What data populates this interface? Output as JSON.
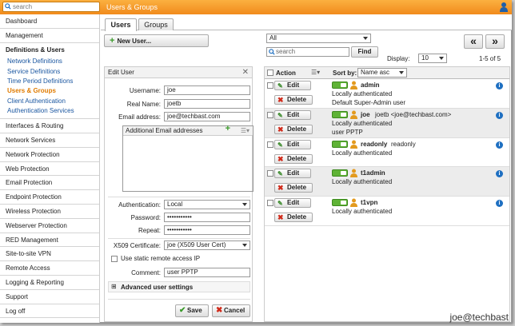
{
  "topbar": {
    "search_placeholder": "search",
    "breadcrumb": "Users & Groups"
  },
  "sidebar": {
    "items_top": [
      "Dashboard",
      "Management"
    ],
    "group": {
      "title": "Definitions & Users",
      "subs": [
        "Network Definitions",
        "Service Definitions",
        "Time Period Definitions",
        "Users & Groups",
        "Client Authentication",
        "Authentication Services"
      ],
      "active": "Users & Groups"
    },
    "items_bottom": [
      "Interfaces & Routing",
      "Network Services",
      "Network Protection",
      "Web Protection",
      "Email Protection",
      "Endpoint Protection",
      "Wireless Protection",
      "Webserver Protection",
      "RED Management",
      "Site-to-site VPN",
      "Remote Access",
      "Logging & Reporting",
      "Support",
      "Log off"
    ]
  },
  "tabs": [
    "Users",
    "Groups"
  ],
  "new_user_label": "New User...",
  "filter": {
    "select_value": "All",
    "search_placeholder": "search",
    "find_label": "Find",
    "display_label": "Display:",
    "display_value": "10",
    "range": "1-5 of 5",
    "prev_label": "«",
    "next_label": "»"
  },
  "edit": {
    "title": "Edit User",
    "username_label": "Username:",
    "username": "joe",
    "realname_label": "Real Name:",
    "realname": "joetb",
    "email_label": "Email address:",
    "email": "joe@techbast.com",
    "additional_label": "Additional Email addresses",
    "auth_label": "Authentication:",
    "auth": "Local",
    "password_label": "Password:",
    "password": "•••••••••••",
    "repeat_label": "Repeat:",
    "repeat": "•••••••••••",
    "x509_label": "X509 Certificate:",
    "x509": "joe (X509 User Cert)",
    "static_label": "Use static remote access IP",
    "comment_label": "Comment:",
    "comment": "user PPTP",
    "advanced_label": "Advanced user settings",
    "save_label": "Save",
    "cancel_label": "Cancel"
  },
  "list": {
    "action_label": "Action",
    "sortby_label": "Sort by:",
    "sort_value": "Name asc",
    "edit_label": "Edit",
    "delete_label": "Delete",
    "rows": [
      {
        "name": "admin",
        "desc": "",
        "l1": "Locally authenticated",
        "l2": "Default Super-Admin user"
      },
      {
        "name": "joe",
        "desc": "joetb <joe@techbast.com>",
        "l1": "Locally authenticated",
        "l2": "user PPTP"
      },
      {
        "name": "readonly",
        "desc": "readonly",
        "l1": "Locally authenticated",
        "l2": ""
      },
      {
        "name": "t1admin",
        "desc": "",
        "l1": "Locally authenticated",
        "l2": ""
      },
      {
        "name": "t1vpn",
        "desc": "",
        "l1": "Locally authenticated",
        "l2": ""
      }
    ]
  },
  "watermark": "joe@techbast"
}
